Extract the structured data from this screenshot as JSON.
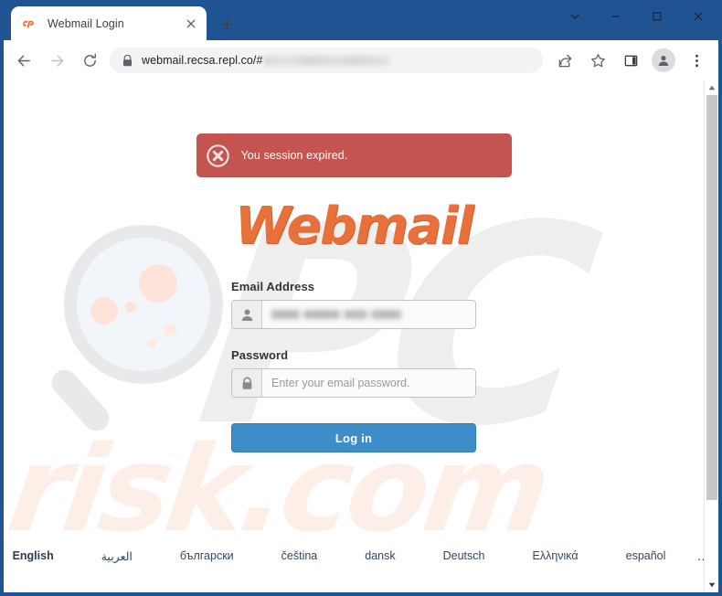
{
  "browser": {
    "tab": {
      "title": "Webmail Login",
      "favicon": "cpanel-icon",
      "close_icon": "close-icon"
    },
    "new_tab_icon": "plus-icon",
    "window_controls": {
      "tab_search": "chevron-down-icon",
      "minimize": "minimize-icon",
      "maximize": "maximize-icon",
      "close": "close-icon"
    },
    "nav": {
      "back_icon": "arrow-left-icon",
      "forward_icon": "arrow-right-icon",
      "reload_icon": "reload-icon"
    },
    "omnibox": {
      "security_icon": "lock-icon",
      "url": "webmail.recsa.repl.co/#",
      "url_redacted": true
    },
    "toolbar_right": {
      "share_icon": "share-icon",
      "bookmark_icon": "star-icon",
      "side_panel_icon": "side-panel-icon",
      "profile_icon": "profile-avatar-icon",
      "menu_icon": "three-dot-menu-icon"
    },
    "scrollbar": {
      "up_icon": "caret-up-icon",
      "down_icon": "caret-down-icon"
    }
  },
  "page": {
    "alert": {
      "icon": "error-circle-x-icon",
      "message": "You session expired."
    },
    "logo_text": "Webmail",
    "watermarks": {
      "top": "PC",
      "bottom": "risk.com"
    },
    "form": {
      "email_label": "Email Address",
      "email_icon": "user-icon",
      "email_value": "",
      "email_placeholder": "",
      "password_label": "Password",
      "password_icon": "lock-icon",
      "password_value": "",
      "password_placeholder": "Enter your email password.",
      "submit_label": "Log in"
    },
    "languages": [
      {
        "label": "English",
        "active": true
      },
      {
        "label": "العربية",
        "active": false
      },
      {
        "label": "български",
        "active": false
      },
      {
        "label": "čeština",
        "active": false
      },
      {
        "label": "dansk",
        "active": false
      },
      {
        "label": "Deutsch",
        "active": false
      },
      {
        "label": "Ελληνικά",
        "active": false
      },
      {
        "label": "español",
        "active": false
      }
    ],
    "languages_more": "…"
  },
  "colors": {
    "window_frame": "#1f5392",
    "alert_bg": "#c4544f",
    "logo_orange": "#e8703a",
    "button_blue": "#3d8dc9",
    "watermark_gray": "#eeeeef",
    "watermark_peach": "#fdefe7"
  }
}
